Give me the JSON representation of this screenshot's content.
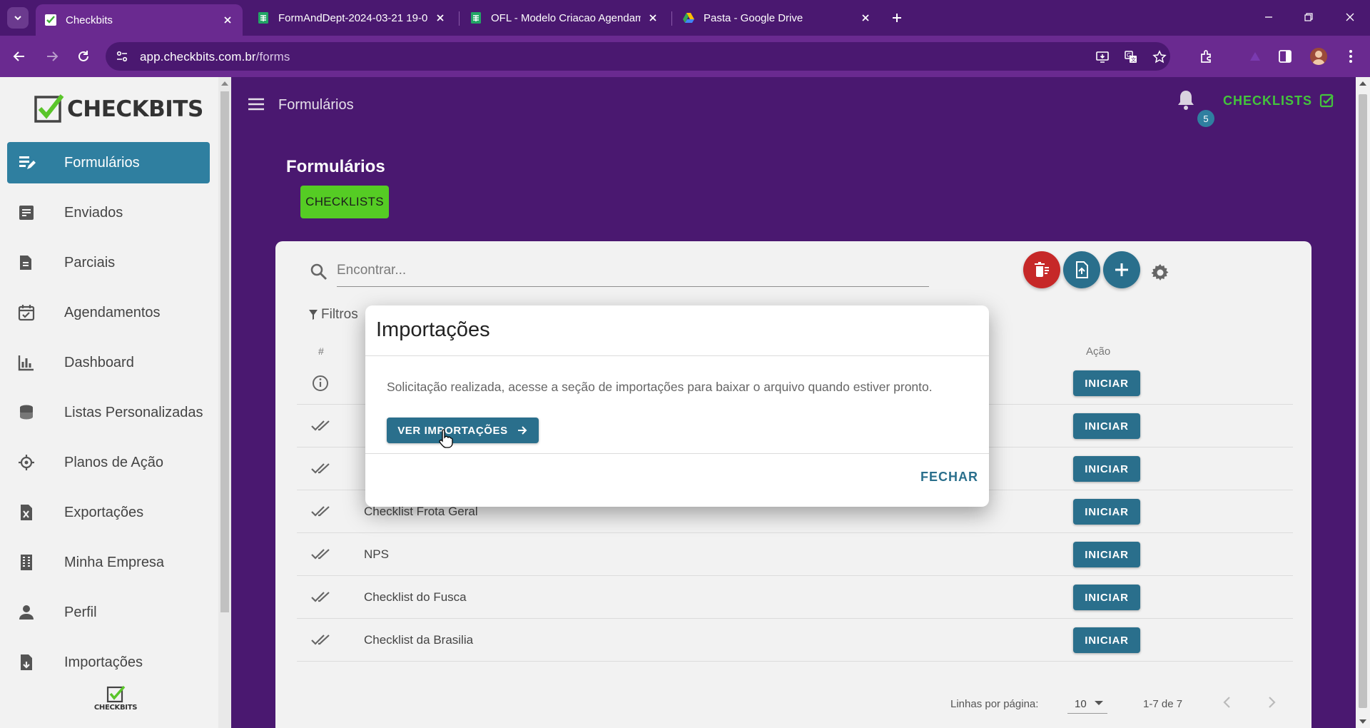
{
  "browser": {
    "tabs": [
      {
        "title": "Checkbits",
        "icon": "checkbits-favicon"
      },
      {
        "title": "FormAndDept-2024-03-21 19-0",
        "icon": "sheets-icon"
      },
      {
        "title": "OFL - Modelo Criacao Agendam",
        "icon": "sheets-icon"
      },
      {
        "title": "Pasta - Google Drive",
        "icon": "drive-icon"
      }
    ],
    "url_host": "app.checkbits.com.br",
    "url_path": "/forms"
  },
  "sidebar": {
    "logo_text": "CHECKBITS",
    "bottom_logo_text": "CHECKBITS",
    "items": [
      {
        "label": "Formulários",
        "icon": "form-edit-icon"
      },
      {
        "label": "Enviados",
        "icon": "sent-list-icon"
      },
      {
        "label": "Parciais",
        "icon": "partial-docs-icon"
      },
      {
        "label": "Agendamentos",
        "icon": "calendar-check-icon"
      },
      {
        "label": "Dashboard",
        "icon": "bar-chart-icon"
      },
      {
        "label": "Listas Personalizadas",
        "icon": "database-icon"
      },
      {
        "label": "Planos de Ação",
        "icon": "crosshair-icon"
      },
      {
        "label": "Exportações",
        "icon": "excel-file-icon"
      },
      {
        "label": "Minha Empresa",
        "icon": "building-icon"
      },
      {
        "label": "Perfil",
        "icon": "person-icon"
      },
      {
        "label": "Importações",
        "icon": "file-import-icon"
      }
    ]
  },
  "header": {
    "title": "Formulários",
    "notification_count": "5",
    "checklists_link": "CHECKLISTS"
  },
  "main": {
    "section_title": "Formulários",
    "chip_label": "CHECKLISTS",
    "search_placeholder": "Encontrar...",
    "filters_label": "Filtros",
    "col_hash": "#",
    "col_acao": "Ação",
    "rows": [
      {
        "name": "",
        "icon": "info-icon",
        "action": "INICIAR"
      },
      {
        "name": "",
        "icon": "double-check-icon",
        "action": "INICIAR"
      },
      {
        "name": "",
        "icon": "double-check-icon",
        "action": "INICIAR"
      },
      {
        "name": "Checklist Frota Geral",
        "icon": "double-check-icon",
        "action": "INICIAR"
      },
      {
        "name": "NPS",
        "icon": "double-check-icon",
        "action": "INICIAR"
      },
      {
        "name": "Checklist do Fusca",
        "icon": "double-check-icon",
        "action": "INICIAR"
      },
      {
        "name": "Checklist da Brasilia",
        "icon": "double-check-icon",
        "action": "INICIAR"
      }
    ],
    "pager": {
      "rows_per_page_label": "Linhas por página:",
      "rows_per_page_value": "10",
      "range": "1-7 de 7"
    }
  },
  "modal": {
    "title": "Importações",
    "message": "Solicitação realizada, acesse a seção de importações para baixar o arquivo quando estiver pronto.",
    "primary_button": "VER IMPORTAÇÕES",
    "close_button": "FECHAR"
  },
  "colors": {
    "brand_purple": "#4a1870",
    "primary_teal": "#2a6f8c",
    "accent_green": "#55cc24",
    "danger_red": "#d32f2f"
  }
}
